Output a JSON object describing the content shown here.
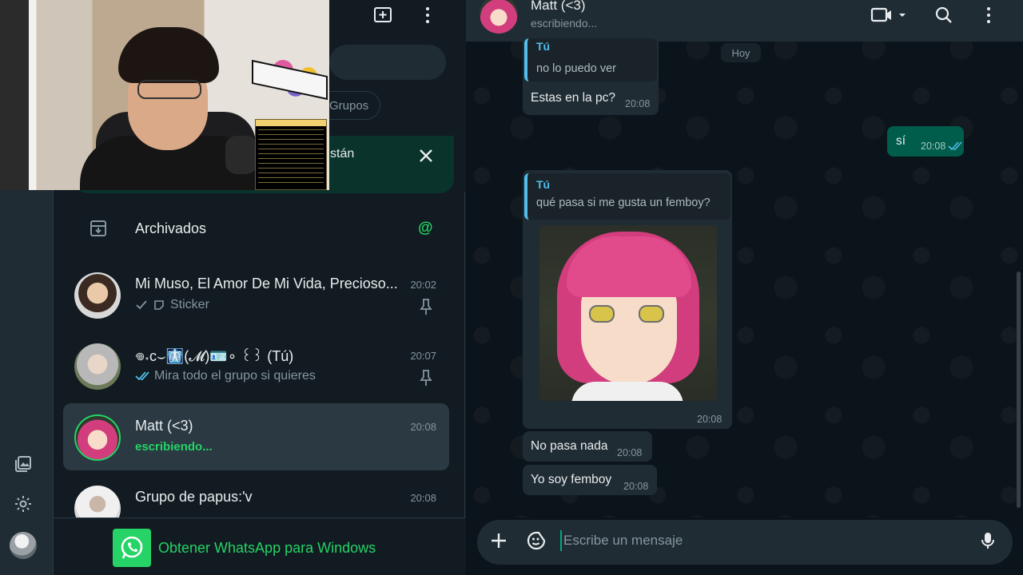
{
  "sidebar_rail": {
    "icons": [
      "media-gallery-icon",
      "settings-gear-icon",
      "profile-avatar"
    ]
  },
  "chat_list": {
    "filter_chip": "Grupos",
    "notice_text": "stán",
    "archived_label": "Archivados",
    "chats": [
      {
        "name": "Mi Muso, El Amor De Mi Vida, Precioso...",
        "time": "20:02",
        "preview": "Sticker",
        "status": "sent",
        "pinned": true
      },
      {
        "name": "𖦹˖ᴄ⌣🩻(𝓜)🪪∘ ꒰꒱ (Tú)",
        "time": "20:07",
        "preview": "Mira todo el grupo si quieres",
        "status": "read",
        "pinned": true
      },
      {
        "name": "Matt (<3)",
        "time": "20:08",
        "preview": "escribiendo...",
        "active": true
      },
      {
        "name": "Grupo de papus:'v",
        "time": "20:08",
        "preview": ""
      }
    ],
    "get_app_label": "Obtener WhatsApp para Windows"
  },
  "conversation": {
    "contact_name": "Matt (<3)",
    "contact_status": "escribiendo...",
    "date_chip": "Hoy",
    "messages": [
      {
        "quote_author": "Tú",
        "quote_text": "no lo puedo ver",
        "text": "Estas en la pc?",
        "time": "20:08",
        "direction": "in"
      },
      {
        "text": "sí",
        "time": "20:08",
        "direction": "out",
        "status": "read"
      },
      {
        "quote_author": "Tú",
        "quote_text": "qué pasa si me gusta un femboy?",
        "image": "anime-character-pink-hair-glasses",
        "time": "20:08",
        "direction": "in"
      },
      {
        "text": "No pasa nada",
        "time": "20:08",
        "direction": "in"
      },
      {
        "text": "Yo soy femboy",
        "time": "20:08",
        "direction": "in"
      }
    ],
    "composer_placeholder": "Escribe un mensaje"
  },
  "colors": {
    "accent_green": "#25d366",
    "outgoing_bubble": "#005c4b",
    "incoming_bubble": "#202c33",
    "quote_bar": "#53bdeb",
    "background": "#0b141a"
  }
}
